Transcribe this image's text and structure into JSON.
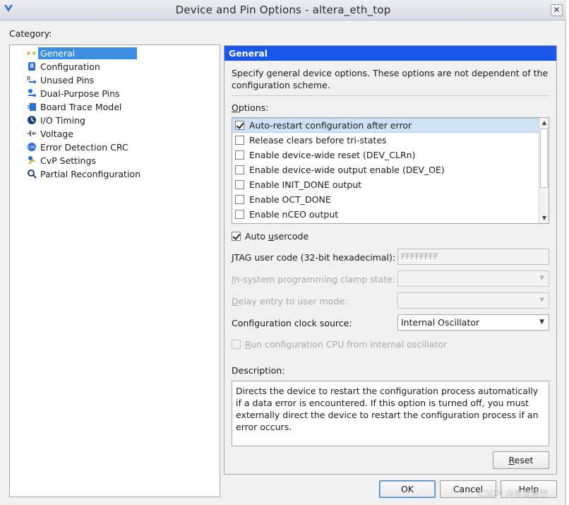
{
  "window": {
    "title": "Device and Pin Options - altera_eth_top",
    "close_glyph": "✕"
  },
  "category": {
    "label": "Category:",
    "items": [
      {
        "label": "General",
        "icon": "stars-icon",
        "selected": true
      },
      {
        "label": "Configuration",
        "icon": "configuration-icon"
      },
      {
        "label": "Unused Pins",
        "icon": "unused-pins-icon"
      },
      {
        "label": "Dual-Purpose Pins",
        "icon": "dual-purpose-pins-icon"
      },
      {
        "label": "Board Trace Model",
        "icon": "board-trace-icon"
      },
      {
        "label": "I/O Timing",
        "icon": "clock-icon"
      },
      {
        "label": "Voltage",
        "icon": "voltage-icon"
      },
      {
        "label": "Error Detection CRC",
        "icon": "crc-icon"
      },
      {
        "label": "CvP Settings",
        "icon": "cvp-icon"
      },
      {
        "label": "Partial Reconfiguration",
        "icon": "gear-search-icon"
      }
    ]
  },
  "general": {
    "header": "General",
    "intro": "Specify general device options. These options are not dependent of the configuration scheme.",
    "options_label_pre": "",
    "options_label_u": "O",
    "options_label_post": "ptions:",
    "options": [
      {
        "label": "Auto-restart configuration after error",
        "checked": true
      },
      {
        "label": "Release clears before tri-states",
        "checked": false
      },
      {
        "label": "Enable device-wide reset (DEV_CLRn)",
        "checked": false
      },
      {
        "label": "Enable device-wide output enable (DEV_OE)",
        "checked": false
      },
      {
        "label": "Enable INIT_DONE output",
        "checked": false
      },
      {
        "label": "Enable OCT_DONE",
        "checked": false
      },
      {
        "label": "Enable nCEO output",
        "checked": false
      }
    ],
    "auto_usercode_pre": "Auto ",
    "auto_usercode_u": "u",
    "auto_usercode_post": "sercode",
    "auto_usercode_checked": true,
    "jtag_label": "JTAG user code (32-bit hexadecimal):",
    "jtag_value": "FFFFFFFF",
    "clamp_label_u": "I",
    "clamp_label_post": "n-system programming clamp state:",
    "delay_label_u": "D",
    "delay_label_post": "elay entry to user mode:",
    "clock_label": "Configuration clock source:",
    "clock_value": "Internal Oscillator",
    "run_cpu_u": "R",
    "run_cpu_post": "un configuration CPU from internal oscillator",
    "description_label": "Description:",
    "description": "Directs the device to restart the configuration process automatically if a data error is encountered. If this option is turned off, you must externally direct the device to restart the configuration process if an error occurs.",
    "reset_u": "R",
    "reset_post": "eset"
  },
  "footer": {
    "ok": "OK",
    "cancel": "Cancel",
    "help": "Help"
  },
  "watermark": "CSDN @零度随想",
  "colors": {
    "header": "#1a56e8",
    "selection": "#3b8ee0"
  }
}
